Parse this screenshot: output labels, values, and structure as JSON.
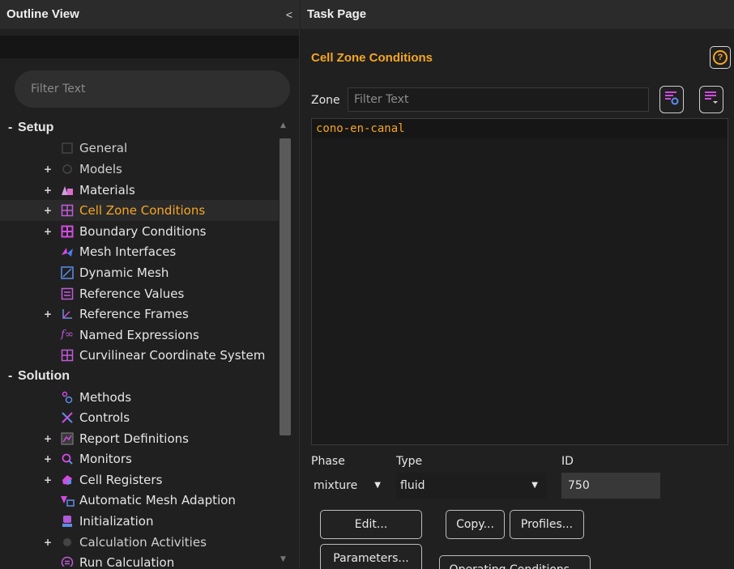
{
  "outline": {
    "title": "Outline View",
    "collapse_glyph": "<",
    "filter_placeholder": "Filter Text",
    "sections": [
      {
        "label": "Setup",
        "items": [
          {
            "label": "General",
            "icon": "general-icon",
            "expandable": false
          },
          {
            "label": "Models",
            "icon": "models-icon",
            "expandable": true
          },
          {
            "label": "Materials",
            "icon": "materials-icon",
            "expandable": true
          },
          {
            "label": "Cell Zone Conditions",
            "icon": "cell-zone-icon",
            "expandable": true,
            "selected": true
          },
          {
            "label": "Boundary Conditions",
            "icon": "boundary-icon",
            "expandable": true
          },
          {
            "label": "Mesh Interfaces",
            "icon": "mesh-interfaces-icon",
            "expandable": false
          },
          {
            "label": "Dynamic Mesh",
            "icon": "dynamic-mesh-icon",
            "expandable": false
          },
          {
            "label": "Reference Values",
            "icon": "reference-values-icon",
            "expandable": false
          },
          {
            "label": "Reference Frames",
            "icon": "reference-frames-icon",
            "expandable": true
          },
          {
            "label": "Named Expressions",
            "icon": "named-expressions-icon",
            "expandable": false
          },
          {
            "label": "Curvilinear Coordinate System",
            "icon": "curvilinear-icon",
            "expandable": false
          }
        ]
      },
      {
        "label": "Solution",
        "items": [
          {
            "label": "Methods",
            "icon": "methods-icon",
            "expandable": false
          },
          {
            "label": "Controls",
            "icon": "controls-icon",
            "expandable": false
          },
          {
            "label": "Report Definitions",
            "icon": "report-definitions-icon",
            "expandable": true
          },
          {
            "label": "Monitors",
            "icon": "monitors-icon",
            "expandable": true
          },
          {
            "label": "Cell Registers",
            "icon": "cell-registers-icon",
            "expandable": true
          },
          {
            "label": "Automatic Mesh Adaption",
            "icon": "mesh-adaption-icon",
            "expandable": false
          },
          {
            "label": "Initialization",
            "icon": "initialization-icon",
            "expandable": false
          },
          {
            "label": "Calculation Activities",
            "icon": "calculation-activities-icon",
            "expandable": true
          },
          {
            "label": "Run Calculation",
            "icon": "run-calculation-icon",
            "expandable": false
          }
        ]
      }
    ]
  },
  "task": {
    "title": "Task Page",
    "section_title": "Cell Zone Conditions",
    "help_glyph": "?",
    "zone_label": "Zone",
    "zone_filter_placeholder": "Filter Text",
    "zones": [
      "cono-en-canal"
    ],
    "phase_label": "Phase",
    "phase_value": "mixture",
    "type_label": "Type",
    "type_value": "fluid",
    "id_label": "ID",
    "id_value": "750",
    "buttons": {
      "edit": "Edit...",
      "copy": "Copy...",
      "profiles": "Profiles...",
      "parameters": "Parameters...",
      "operating": "Operating Conditions..."
    }
  },
  "colors": {
    "accent": "#f5a623",
    "background": "#202020",
    "header": "#2b2b2b"
  }
}
